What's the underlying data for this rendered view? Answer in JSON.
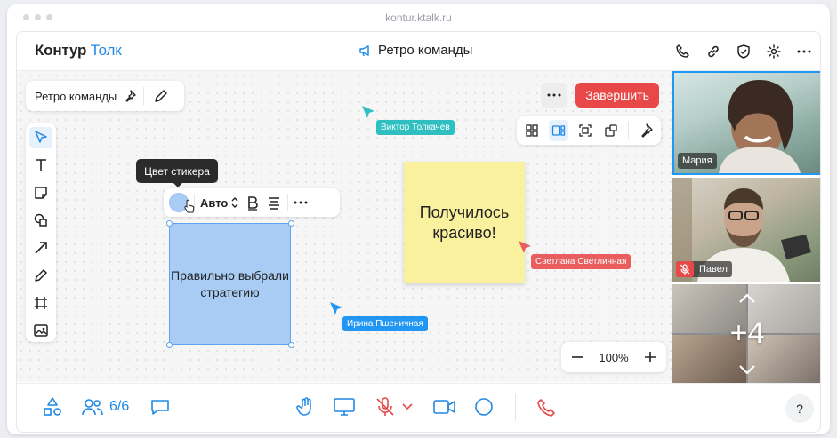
{
  "browser": {
    "url": "kontur.ktalk.ru"
  },
  "header": {
    "logo_main": "Контур",
    "logo_accent": "Толк",
    "meeting_title": "Ретро команды"
  },
  "board": {
    "title": "Ретро команды",
    "finish_label": "Завершить",
    "zoom_level": "100%"
  },
  "sticker_toolbar": {
    "tooltip": "Цвет стикера",
    "font_label": "Авто",
    "color": "#a9ccf5"
  },
  "notes": [
    {
      "text": "Правильно выбрали стратегию",
      "color": "#a9ccf5"
    },
    {
      "text": "Получилось красиво!",
      "color": "#faf19f"
    }
  ],
  "cursors": [
    {
      "name": "Виктор Толкачев",
      "color": "#2fbfc0"
    },
    {
      "name": "Светлана Светличная",
      "color": "#e85d5d"
    },
    {
      "name": "Ирина Пшеничная",
      "color": "#2196f3"
    }
  ],
  "participants": {
    "tiles": [
      {
        "name": "Мария",
        "muted": false
      },
      {
        "name": "Павел",
        "muted": true
      }
    ],
    "more_count": "+4"
  },
  "bottombar": {
    "participants_count": "6/6"
  },
  "help_label": "?",
  "colors": {
    "accent": "#1e88e5",
    "danger": "#e84848"
  }
}
